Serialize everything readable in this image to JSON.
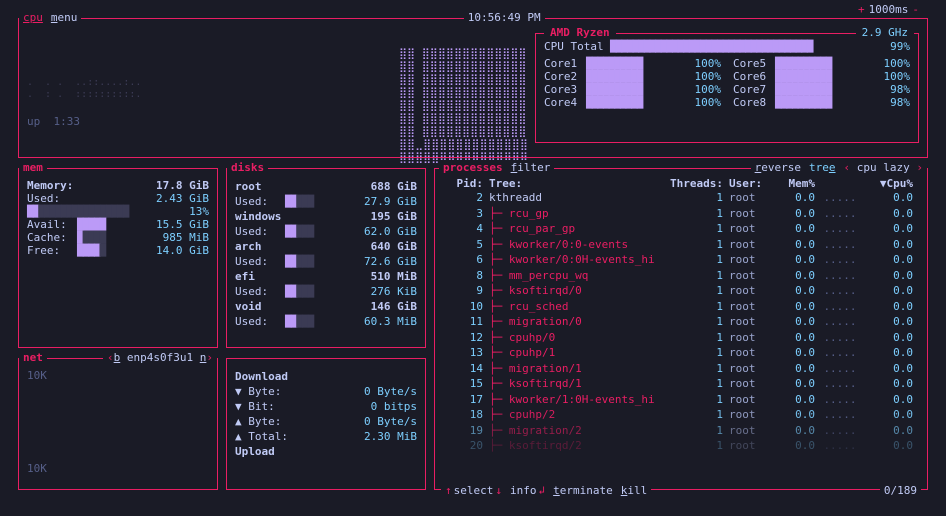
{
  "clock": "10:56:49 PM",
  "update_rate": "1000ms",
  "cpu": {
    "label": "cpu",
    "menu": "menu",
    "model": "AMD Ryzen",
    "freq": "2.9 GHz",
    "total_label": "CPU Total",
    "total_pct": "99%",
    "cores": [
      {
        "name": "Core1",
        "pct": "100%"
      },
      {
        "name": "Core2",
        "pct": "100%"
      },
      {
        "name": "Core3",
        "pct": "100%"
      },
      {
        "name": "Core4",
        "pct": "100%"
      },
      {
        "name": "Core5",
        "pct": "100%"
      },
      {
        "name": "Core6",
        "pct": "100%"
      },
      {
        "name": "Core7",
        "pct": "98%"
      },
      {
        "name": "Core8",
        "pct": "98%"
      }
    ],
    "uptime_label": "up",
    "uptime": "1:33"
  },
  "mem": {
    "label": "mem",
    "total_label": "Memory:",
    "total": "17.8 GiB",
    "used_label": "Used:",
    "used": "2.43 GiB",
    "used_pct": "13%",
    "avail_label": "Avail:",
    "avail": "15.5 GiB",
    "cache_label": "Cache:",
    "cache": "985 MiB",
    "free_label": "Free:",
    "free": "14.0 GiB"
  },
  "disks": {
    "label": "disks",
    "list": [
      {
        "name": "root",
        "size": "688 GiB",
        "used_label": "Used:",
        "used": "27.9 GiB"
      },
      {
        "name": "windows",
        "size": "195 GiB",
        "used_label": "Used:",
        "used": "62.0 GiB"
      },
      {
        "name": "arch",
        "size": "640 GiB",
        "used_label": "Used:",
        "used": "72.6 GiB"
      },
      {
        "name": "efi",
        "size": "510 MiB",
        "used_label": "Used:",
        "used": "276 KiB"
      },
      {
        "name": "void",
        "size": "146 GiB",
        "used_label": "Used:",
        "used": "60.3 MiB"
      }
    ]
  },
  "net": {
    "label": "net",
    "iface": "enp4s0f3u1",
    "y1": "10K",
    "y2": "10K",
    "download_label": "Download",
    "upload_label": "Upload",
    "rows": [
      {
        "k": "▼ Byte:",
        "v": "0 Byte/s"
      },
      {
        "k": "▼ Bit:",
        "v": "0 bitps"
      },
      {
        "k": "▲ Byte:",
        "v": "0 Byte/s"
      },
      {
        "k": "▲ Total:",
        "v": "2.30 MiB"
      }
    ]
  },
  "proc": {
    "label": "processes",
    "filter": "filter",
    "reverse": "reverse",
    "tree": "tree",
    "mode": "cpu lazy",
    "cols": {
      "pid": "Pid:",
      "tree": "Tree:",
      "threads": "Threads:",
      "user": "User:",
      "mem": "Mem%",
      "cpu": "▼Cpu%"
    },
    "footer": {
      "select": "select",
      "info": "info",
      "terminate": "terminate",
      "kill": "kill",
      "pos": "0/189"
    },
    "rows": [
      {
        "pid": "2",
        "name": "kthreadd",
        "depth": 0,
        "thr": "1",
        "user": "root",
        "mem": "0.0",
        "cpu": "0.0"
      },
      {
        "pid": "3",
        "name": "rcu_gp",
        "depth": 1,
        "thr": "1",
        "user": "root",
        "mem": "0.0",
        "cpu": "0.0"
      },
      {
        "pid": "4",
        "name": "rcu_par_gp",
        "depth": 1,
        "thr": "1",
        "user": "root",
        "mem": "0.0",
        "cpu": "0.0"
      },
      {
        "pid": "5",
        "name": "kworker/0:0-events",
        "depth": 1,
        "thr": "1",
        "user": "root",
        "mem": "0.0",
        "cpu": "0.0"
      },
      {
        "pid": "6",
        "name": "kworker/0:0H-events_hi",
        "depth": 1,
        "thr": "1",
        "user": "root",
        "mem": "0.0",
        "cpu": "0.0"
      },
      {
        "pid": "8",
        "name": "mm_percpu_wq",
        "depth": 1,
        "thr": "1",
        "user": "root",
        "mem": "0.0",
        "cpu": "0.0"
      },
      {
        "pid": "9",
        "name": "ksoftirqd/0",
        "depth": 1,
        "thr": "1",
        "user": "root",
        "mem": "0.0",
        "cpu": "0.0"
      },
      {
        "pid": "10",
        "name": "rcu_sched",
        "depth": 1,
        "thr": "1",
        "user": "root",
        "mem": "0.0",
        "cpu": "0.0"
      },
      {
        "pid": "11",
        "name": "migration/0",
        "depth": 1,
        "thr": "1",
        "user": "root",
        "mem": "0.0",
        "cpu": "0.0"
      },
      {
        "pid": "12",
        "name": "cpuhp/0",
        "depth": 1,
        "thr": "1",
        "user": "root",
        "mem": "0.0",
        "cpu": "0.0"
      },
      {
        "pid": "13",
        "name": "cpuhp/1",
        "depth": 1,
        "thr": "1",
        "user": "root",
        "mem": "0.0",
        "cpu": "0.0"
      },
      {
        "pid": "14",
        "name": "migration/1",
        "depth": 1,
        "thr": "1",
        "user": "root",
        "mem": "0.0",
        "cpu": "0.0"
      },
      {
        "pid": "15",
        "name": "ksoftirqd/1",
        "depth": 1,
        "thr": "1",
        "user": "root",
        "mem": "0.0",
        "cpu": "0.0"
      },
      {
        "pid": "17",
        "name": "kworker/1:0H-events_hi",
        "depth": 1,
        "thr": "1",
        "user": "root",
        "mem": "0.0",
        "cpu": "0.0"
      },
      {
        "pid": "18",
        "name": "cpuhp/2",
        "depth": 1,
        "thr": "1",
        "user": "root",
        "mem": "0.0",
        "cpu": "0.0"
      },
      {
        "pid": "19",
        "name": "migration/2",
        "depth": 1,
        "thr": "1",
        "user": "root",
        "mem": "0.0",
        "cpu": "0.0"
      },
      {
        "pid": "20",
        "name": "ksoftirqd/2",
        "depth": 1,
        "thr": "1",
        "user": "root",
        "mem": "0.0",
        "cpu": "0.0"
      }
    ]
  }
}
